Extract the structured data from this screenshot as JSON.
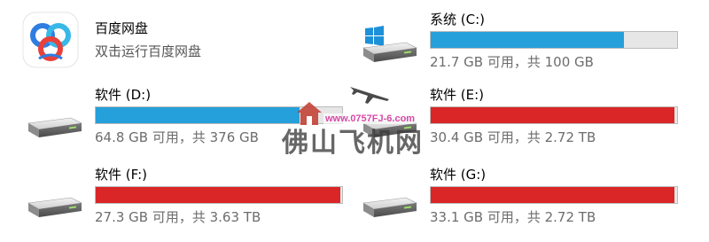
{
  "apps": [
    {
      "name": "百度网盘",
      "subtitle": "双击运行百度网盘",
      "icon": "baidu-netdisk-icon"
    }
  ],
  "drives": {
    "c": {
      "name": "系统 (C:)",
      "free_text": "21.7 GB 可用，共 100 GB",
      "used_fraction": 0.783,
      "bar_color": "#26a0da",
      "icon": "windows-system-drive-icon"
    },
    "d": {
      "name": "软件 (D:)",
      "free_text": "64.8 GB 可用，共 376 GB",
      "used_fraction": 0.828,
      "bar_color": "#26a0da",
      "icon": "hard-drive-icon"
    },
    "e": {
      "name": "软件 (E:)",
      "free_text": "30.4 GB 可用，共 2.72 TB",
      "used_fraction": 0.989,
      "bar_color": "#da2626",
      "icon": "hard-drive-icon"
    },
    "f": {
      "name": "软件 (F:)",
      "free_text": "27.3 GB 可用，共 3.63 TB",
      "used_fraction": 0.993,
      "bar_color": "#da2626",
      "icon": "hard-drive-icon"
    },
    "g": {
      "name": "软件 (G:)",
      "free_text": "33.1 GB 可用，共 2.72 TB",
      "used_fraction": 0.988,
      "bar_color": "#da2626",
      "icon": "hard-drive-icon"
    }
  },
  "watermark": {
    "url": "www.0757FJ-6.com",
    "text": "佛山飞机网"
  }
}
